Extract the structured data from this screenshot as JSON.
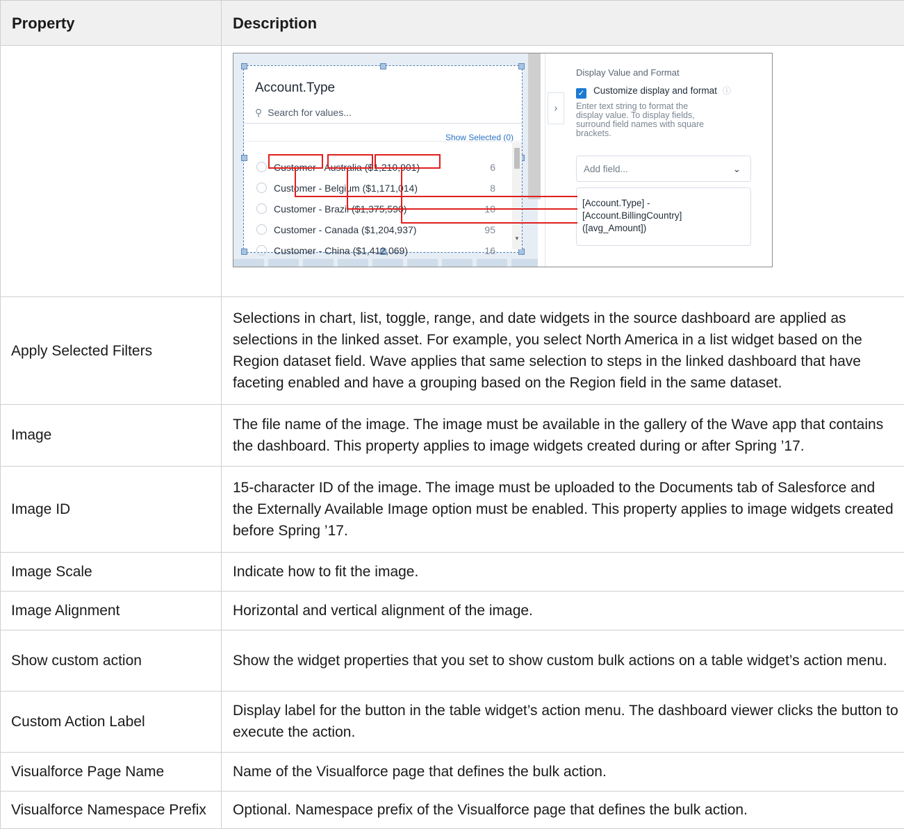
{
  "table": {
    "header": {
      "property": "Property",
      "description": "Description"
    },
    "rows": [
      {
        "property": "Apply Selected Filters",
        "description": "Selections in chart, list, toggle, range, and date widgets in the source dashboard are applied as selections in the linked asset. For example, you select North America in a list widget based on the Region dataset field. Wave applies that same selection to steps in the linked dashboard that have faceting enabled and have a grouping based on the Region field in the same dataset."
      },
      {
        "property": "Image",
        "description": "The file name of the image. The image must be available in the gallery of the Wave app that contains the dashboard. This property applies to image widgets created during or after Spring ’17."
      },
      {
        "property": "Image ID",
        "description": "15-character ID of the image. The image must be uploaded to the Documents tab of Salesforce and the Externally Available Image option must be enabled. This property applies to image widgets created before Spring ’17."
      },
      {
        "property": "Image Scale",
        "description": "Indicate how to fit the image."
      },
      {
        "property": "Image Alignment",
        "description": "Horizontal and vertical alignment of the image."
      },
      {
        "property": "Show custom action",
        "description": "Show the widget properties that you set to show custom bulk actions on a table widget’s action menu."
      },
      {
        "property": "Custom Action Label",
        "description": "Display label for the button in the table widget’s action menu. The dashboard viewer clicks the button to execute the action."
      },
      {
        "property": "Visualforce Page Name",
        "description": "Name of the Visualforce page that defines the bulk action."
      },
      {
        "property": "Visualforce Namespace Prefix",
        "description": "Optional. Namespace prefix of the Visualforce page that defines the bulk action."
      }
    ]
  },
  "screenshot": {
    "widget": {
      "title": "Account.Type",
      "search_placeholder": "Search for values...",
      "show_selected": "Show Selected (0)",
      "items": [
        {
          "label": "Customer - Australia ($1,210,901)",
          "count": "6"
        },
        {
          "label": "Customer - Belgium ($1,171,014)",
          "count": "8"
        },
        {
          "label": "Customer - Brazil ($1,375,590)",
          "count": "10"
        },
        {
          "label": "Customer - Canada ($1,204,937)",
          "count": "95"
        },
        {
          "label": "Customer - China ($1,412,069)",
          "count": "16"
        }
      ]
    },
    "panel": {
      "section_title": "Display Value and Format",
      "checkbox_label": "Customize display and format",
      "help_lines": [
        "Enter text string to format the",
        "display value. To display fields,",
        "surround field names with square",
        "brackets."
      ],
      "select_placeholder": "Add field...",
      "format_lines": [
        "[Account.Type] -",
        "[Account.BillingCountry]",
        "([avg_Amount])"
      ]
    },
    "icons": {
      "search": "search-icon",
      "collapse": "chevron-right-icon",
      "checkbox": "check-icon",
      "info": "info-icon",
      "dropdown": "chevron-down-icon"
    },
    "colors": {
      "annotation": "#e01e1e",
      "accent": "#1c7ad4"
    }
  }
}
